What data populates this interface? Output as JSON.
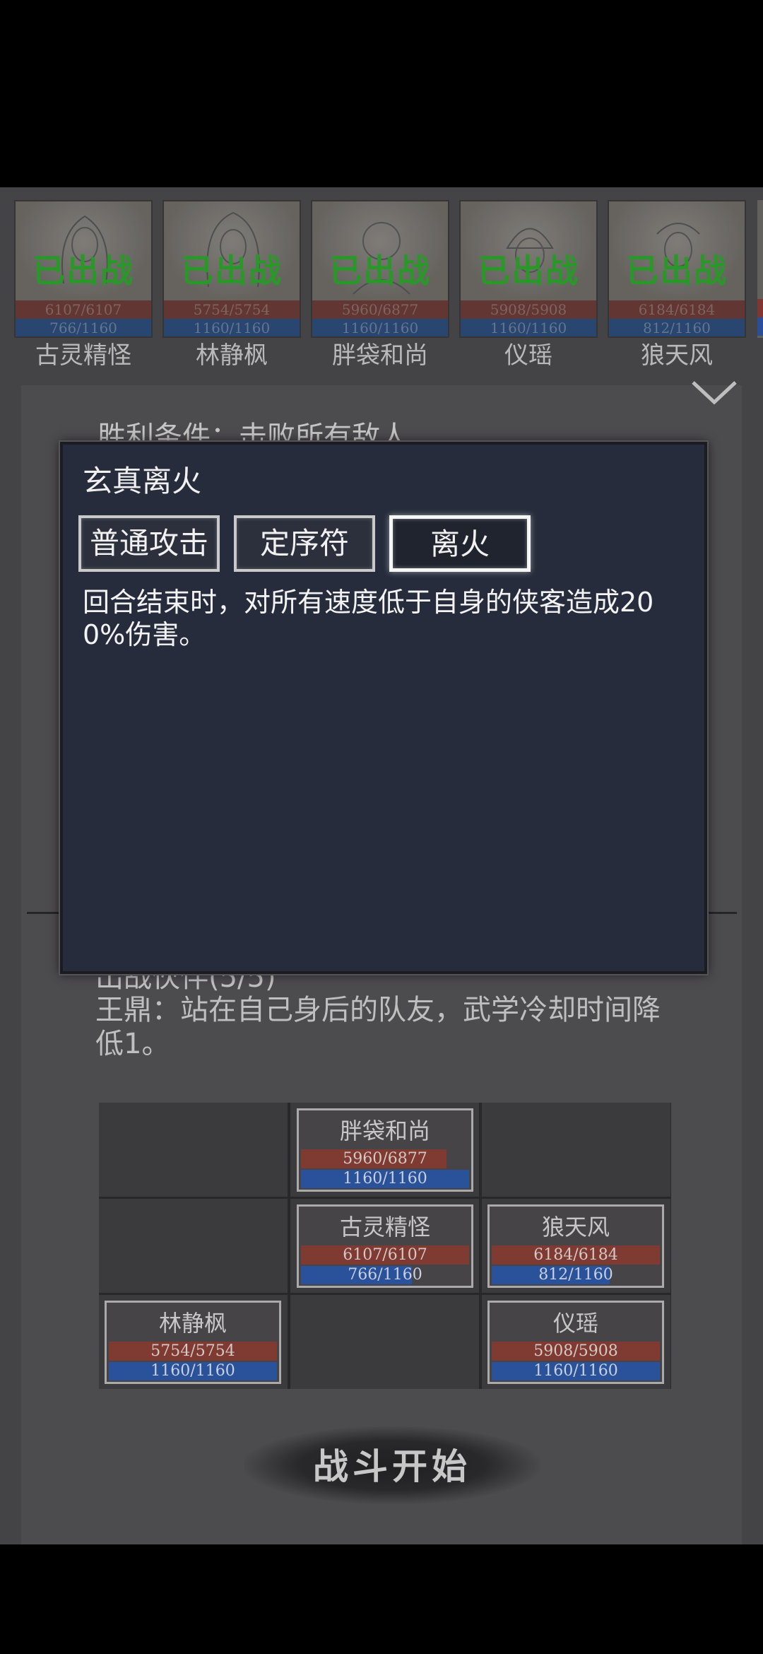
{
  "roster": [
    {
      "name": "古灵精怪",
      "status": "已出战",
      "hp": "6107/6107",
      "mp": "766/1160"
    },
    {
      "name": "林静枫",
      "status": "已出战",
      "hp": "5754/5754",
      "mp": "1160/1160"
    },
    {
      "name": "胖袋和尚",
      "status": "已出战",
      "hp": "5960/6877",
      "mp": "1160/1160"
    },
    {
      "name": "仪瑶",
      "status": "已出战",
      "hp": "5908/5908",
      "mp": "1160/1160"
    },
    {
      "name": "狼天风",
      "status": "已出战",
      "hp": "6184/6184",
      "mp": "812/1160"
    }
  ],
  "panel": {
    "victory_condition": "胜利条件：击败所有敌人",
    "partner_title": "出战伙伴(5/5)",
    "partner_desc": "王鼎：站在自己身后的队友，武学冷却时间降低1。"
  },
  "formation": [
    {
      "row": 0,
      "col": 1,
      "name": "胖袋和尚",
      "hp": "5960/6877",
      "mp": "1160/1160",
      "hp_ratio": 0.867,
      "mp_ratio": 1.0
    },
    {
      "row": 1,
      "col": 1,
      "name": "古灵精怪",
      "hp": "6107/6107",
      "mp": "766/1160",
      "hp_ratio": 1.0,
      "mp_ratio": 0.66
    },
    {
      "row": 1,
      "col": 2,
      "name": "狼天风",
      "hp": "6184/6184",
      "mp": "812/1160",
      "hp_ratio": 1.0,
      "mp_ratio": 0.7
    },
    {
      "row": 2,
      "col": 0,
      "name": "林静枫",
      "hp": "5754/5754",
      "mp": "1160/1160",
      "hp_ratio": 1.0,
      "mp_ratio": 1.0
    },
    {
      "row": 2,
      "col": 2,
      "name": "仪瑶",
      "hp": "5908/5908",
      "mp": "1160/1160",
      "hp_ratio": 1.0,
      "mp_ratio": 1.0
    }
  ],
  "start_button": "战斗开始",
  "dialog": {
    "title": "玄真离火",
    "tabs": [
      "普通攻击",
      "定序符",
      "离火"
    ],
    "active_tab": 2,
    "description": "回合结束时，对所有速度低于自身的侠客造成200%伤害。"
  },
  "colors": {
    "deployed_green": "#2ea52c",
    "hp_red": "#8a3f37",
    "mp_blue": "#2e5aa8",
    "dialog_bg": "#262c3b"
  }
}
